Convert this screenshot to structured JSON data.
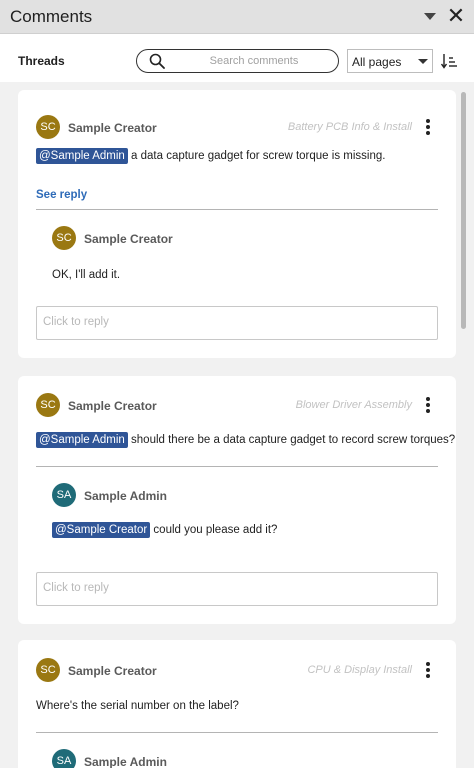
{
  "panel": {
    "title": "Comments",
    "threads_label": "Threads",
    "search_placeholder": "Search comments",
    "pages_filter": "All pages",
    "icons": [
      "collapse-caret-icon",
      "close-icon",
      "search-icon",
      "chevron-down-icon",
      "sort-icon",
      "more-options-icon"
    ]
  },
  "colors": {
    "creator_avatar": "#9a7812",
    "admin_avatar": "#1f6b78",
    "mention_bg": "#2f5597",
    "link": "#2e6bb8"
  },
  "threads": [
    {
      "author_initials": "SC",
      "author": "Sample Creator",
      "page": "Battery PCB Info & Install",
      "mention": "@Sample Admin",
      "text": "a data capture gadget for screw torque is missing.",
      "see_reply": "See reply",
      "reply": {
        "author_initials": "SC",
        "author": "Sample Creator",
        "mention": "",
        "text": "OK, I'll add it."
      },
      "reply_placeholder": "Click to reply"
    },
    {
      "author_initials": "SC",
      "author": "Sample Creator",
      "page": "Blower Driver Assembly",
      "mention": "@Sample Admin",
      "text": "should there be a data capture gadget to record screw torques?",
      "reply": {
        "author_initials": "SA",
        "author": "Sample Admin",
        "mention": "@Sample Creator",
        "text": "could you please add it?"
      },
      "reply_placeholder": "Click to reply"
    },
    {
      "author_initials": "SC",
      "author": "Sample Creator",
      "page": "CPU & Display Install",
      "text": "Where's the serial number on the label?",
      "reply": {
        "author_initials": "SA",
        "author": "Sample Admin"
      }
    }
  ]
}
